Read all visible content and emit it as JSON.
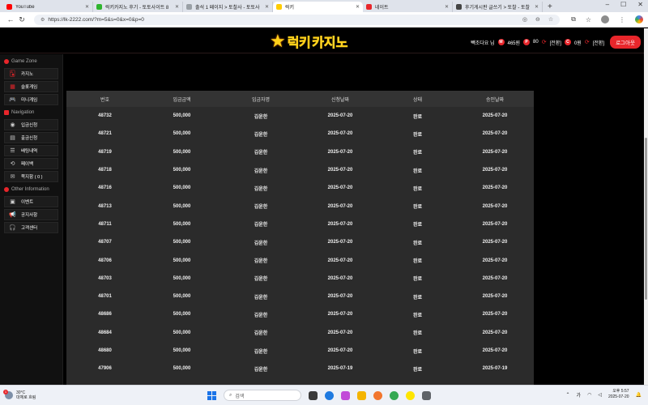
{
  "browser": {
    "tabs": [
      {
        "label": "YouTube",
        "color": "#ff0000",
        "active": false
      },
      {
        "label": "럭키카지노 후기 - 토토사이트 8",
        "color": "#2fb52f",
        "active": false
      },
      {
        "label": "출석 1 페이지 > 토찰사 - 토토사",
        "color": "#9aa0a6",
        "active": false
      },
      {
        "label": "럭키",
        "color": "#ffcc00",
        "active": true
      },
      {
        "label": "네이트",
        "color": "#e8262b",
        "active": false
      },
      {
        "label": "후기게시판 글쓰기 > 토찰 - 토찰",
        "color": "#444444",
        "active": false
      }
    ],
    "url": "https://lk-2222.com/?m=5&s=0&x=0&p=0"
  },
  "site": {
    "logo_main": "럭키",
    "logo_accent": "카지노",
    "user_name": "빽조다요 님",
    "money_badge": "M",
    "money": "465원",
    "point_badge": "P",
    "point": "80",
    "convert_label": "[전환]",
    "coupon_badge": "C",
    "coupon": "0원",
    "convert_label2": "[전환]",
    "logout_label": "로그아웃",
    "accent_color": "#e8262b"
  },
  "sidebar": {
    "sections": [
      {
        "title": "Game Zone",
        "items": [
          {
            "label": "카지노",
            "icon": "cards-icon"
          },
          {
            "label": "슬롯게임",
            "icon": "slot-icon"
          },
          {
            "label": "미니게임",
            "icon": "gamepad-icon"
          }
        ]
      },
      {
        "title": "Navigation",
        "items": [
          {
            "label": "입금신청",
            "icon": "deposit-icon"
          },
          {
            "label": "출금신청",
            "icon": "withdraw-icon"
          },
          {
            "label": "배팅내역",
            "icon": "history-icon"
          },
          {
            "label": "페이백",
            "icon": "payback-icon"
          },
          {
            "label": "쪽지함 ( 0 )",
            "icon": "mail-icon"
          }
        ]
      },
      {
        "title": "Other Information",
        "items": [
          {
            "label": "이벤트",
            "icon": "gift-icon"
          },
          {
            "label": "공지사항",
            "icon": "megaphone-icon"
          },
          {
            "label": "고객센터",
            "icon": "headset-icon"
          }
        ]
      }
    ]
  },
  "table": {
    "headers": [
      "번호",
      "입금금액",
      "입금자명",
      "신청날짜",
      "상태",
      "승인날짜"
    ],
    "rows": [
      [
        "48732",
        "500,000",
        "김윤한",
        "2025-07-20",
        "완료",
        "2025-07-20"
      ],
      [
        "48721",
        "500,000",
        "김윤한",
        "2025-07-20",
        "완료",
        "2025-07-20"
      ],
      [
        "48719",
        "500,000",
        "김윤한",
        "2025-07-20",
        "완료",
        "2025-07-20"
      ],
      [
        "48718",
        "500,000",
        "김윤한",
        "2025-07-20",
        "완료",
        "2025-07-20"
      ],
      [
        "48716",
        "500,000",
        "김윤한",
        "2025-07-20",
        "완료",
        "2025-07-20"
      ],
      [
        "48713",
        "500,000",
        "김윤한",
        "2025-07-20",
        "완료",
        "2025-07-20"
      ],
      [
        "48711",
        "500,000",
        "김윤한",
        "2025-07-20",
        "완료",
        "2025-07-20"
      ],
      [
        "48707",
        "500,000",
        "김윤한",
        "2025-07-20",
        "완료",
        "2025-07-20"
      ],
      [
        "48706",
        "500,000",
        "김윤한",
        "2025-07-20",
        "완료",
        "2025-07-20"
      ],
      [
        "48703",
        "500,000",
        "김윤한",
        "2025-07-20",
        "완료",
        "2025-07-20"
      ],
      [
        "48701",
        "500,000",
        "김윤한",
        "2025-07-20",
        "완료",
        "2025-07-20"
      ],
      [
        "48686",
        "500,000",
        "김윤한",
        "2025-07-20",
        "완료",
        "2025-07-20"
      ],
      [
        "48684",
        "500,000",
        "김윤한",
        "2025-07-20",
        "완료",
        "2025-07-20"
      ],
      [
        "48680",
        "500,000",
        "김윤한",
        "2025-07-20",
        "완료",
        "2025-07-20"
      ],
      [
        "47906",
        "500,000",
        "김윤한",
        "2025-07-19",
        "완료",
        "2025-07-19"
      ]
    ]
  },
  "taskbar": {
    "weather_temp": "30°C",
    "weather_desc": "대체로 흐림",
    "weather_badge": "1",
    "search_placeholder": "검색",
    "time": "오후 5:57",
    "date": "2025-07-20",
    "lang": "가"
  }
}
